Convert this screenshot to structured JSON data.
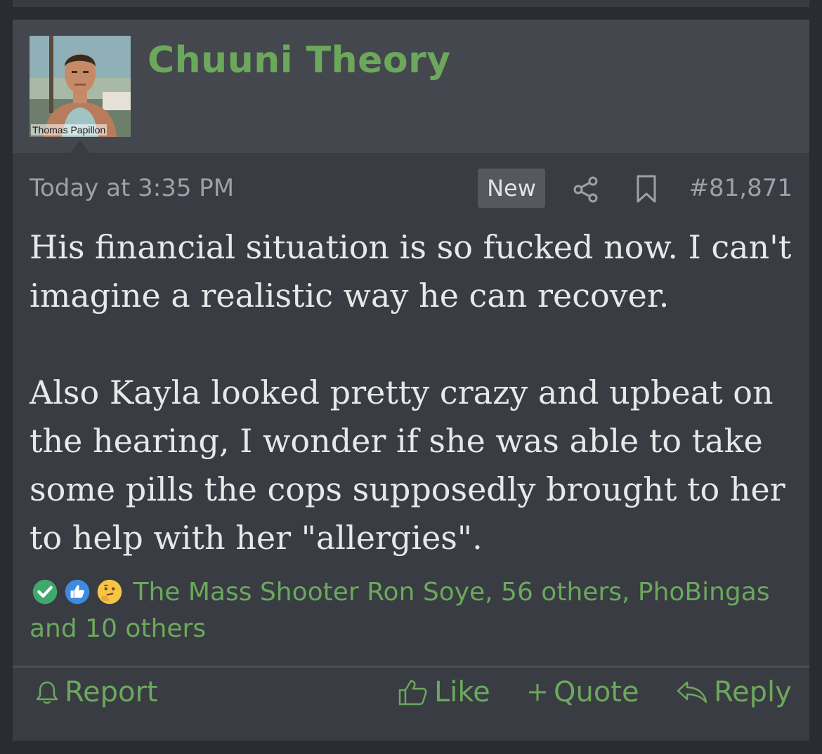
{
  "post": {
    "username": "Chuuni Theory",
    "avatar_caption": "Thomas Papillon",
    "timestamp": "Today at 3:35 PM",
    "badge": "New",
    "post_number": "#81,871",
    "paragraphs": [
      "His financial situation is so fucked now. I can't imagine a realistic way he can recover.",
      "Also Kayla looked pretty crazy and upbeat on the hearing, I wonder if she was able to take some pills the cops supposedly brought to her to help with her \"allergies\"."
    ],
    "reactions": {
      "icons": [
        "check-reaction-icon",
        "thumbs-up-reaction-icon",
        "thinking-face-reaction-icon"
      ],
      "text": "The Mass Shooter Ron Soye, 56 others, PhoBingas and 10 others"
    },
    "actions": {
      "report": "Report",
      "like": "Like",
      "quote": "Quote",
      "reply": "Reply"
    }
  },
  "colors": {
    "accent": "#6ca85c",
    "background": "#2a2c31",
    "card": "#393c43",
    "header": "#44474e",
    "text": "#e8e8e8",
    "muted": "#9da1a8"
  }
}
